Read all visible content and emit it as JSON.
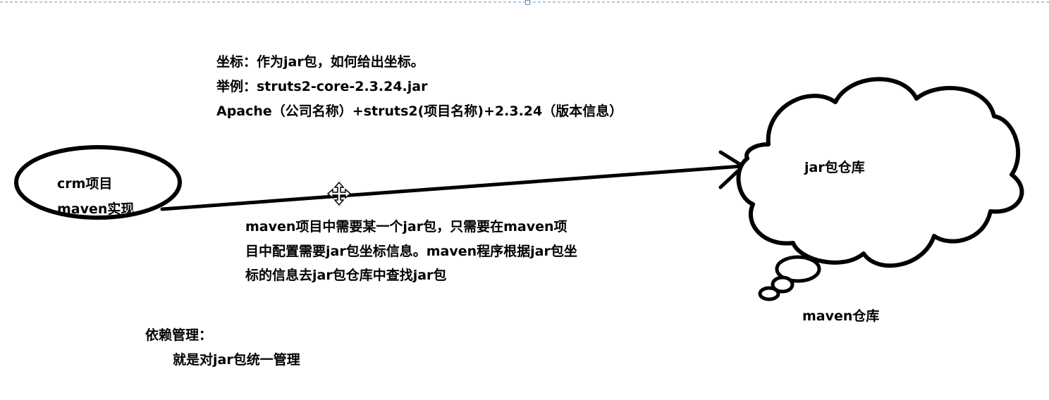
{
  "coordinate_note": {
    "line1": "坐标：作为jar包，如何给出坐标。",
    "line2": "举例：struts2-core-2.3.24.jar",
    "line3": "Apache（公司名称）+struts2(项目名称)+2.3.24（版本信息）"
  },
  "project_node": {
    "line1": "crm项目",
    "line2": "maven实现"
  },
  "repository_node": {
    "inner_label": "jar包仓库",
    "caption": "maven仓库"
  },
  "explanation": {
    "line1": "maven项目中需要某一个jar包，只需要在maven项",
    "line2": "目中配置需要jar包坐标信息。maven程序根据jar包坐",
    "line3": "标的信息去jar包仓库中查找jar包"
  },
  "dependency": {
    "title": "依赖管理：",
    "detail": "就是对jar包统一管理"
  },
  "colors": {
    "stroke": "#000000",
    "selection_border": "#6b8fb0",
    "background": "#ffffff"
  },
  "icons": {
    "cursor": "move-cursor-icon"
  }
}
